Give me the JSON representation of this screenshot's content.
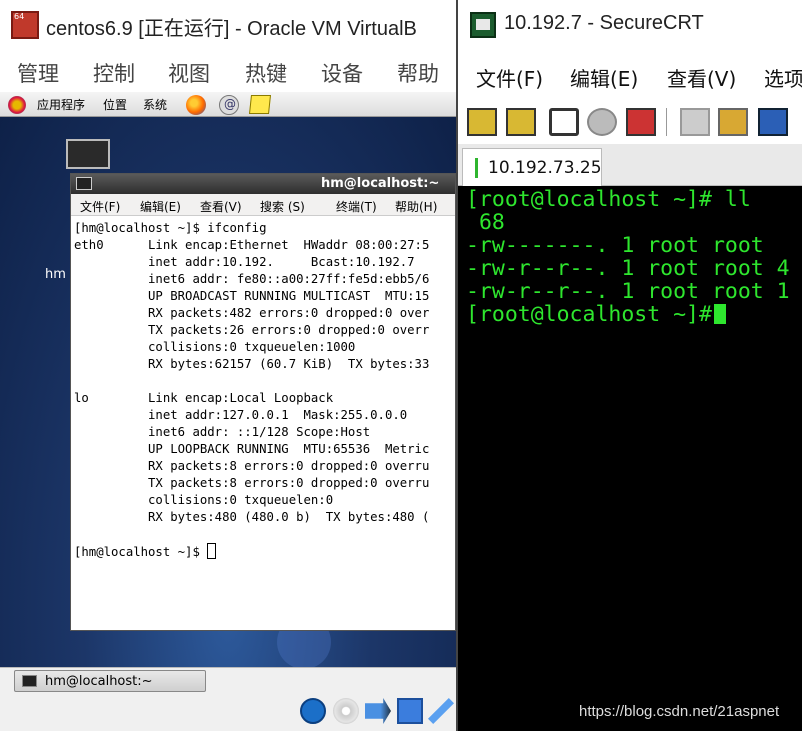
{
  "vbox": {
    "title": "centos6.9 [正在运行] - Oracle VM VirtualB",
    "app_icon_badge": "64",
    "menu": [
      "管理",
      "控制",
      "视图",
      "热键",
      "设备",
      "帮助"
    ]
  },
  "guest": {
    "panel": {
      "applications": "应用程序",
      "places": "位置",
      "system": "系统"
    },
    "desktop_icon_label": "hm",
    "terminal": {
      "title": "hm@localhost:~",
      "menu": [
        "文件(F)",
        "编辑(E)",
        "查看(V)",
        "搜索 (S)",
        "终端(T)",
        "帮助(H)"
      ],
      "lines": [
        "[hm@localhost ~]$ ifconfig",
        "eth0      Link encap:Ethernet  HWaddr 08:00:27:5",
        "          inet addr:10.192.     Bcast:10.192.7",
        "          inet6 addr: fe80::a00:27ff:fe5d:ebb5/6",
        "          UP BROADCAST RUNNING MULTICAST  MTU:15",
        "          RX packets:482 errors:0 dropped:0 over",
        "          TX packets:26 errors:0 dropped:0 overr",
        "          collisions:0 txqueuelen:1000",
        "          RX bytes:62157 (60.7 KiB)  TX bytes:33",
        "",
        "lo        Link encap:Local Loopback",
        "          inet addr:127.0.0.1  Mask:255.0.0.0",
        "          inet6 addr: ::1/128 Scope:Host",
        "          UP LOOPBACK RUNNING  MTU:65536  Metric",
        "          RX packets:8 errors:0 dropped:0 overru",
        "          TX packets:8 errors:0 dropped:0 overru",
        "          collisions:0 txqueuelen:0",
        "          RX bytes:480 (480.0 b)  TX bytes:480 (",
        "",
        "[hm@localhost ~]$ "
      ]
    },
    "taskbar_item": "hm@localhost:~"
  },
  "crt": {
    "title": "10.192.7      - SecureCRT",
    "menu": [
      "文件(F)",
      "编辑(E)",
      "查看(V)",
      "选项"
    ],
    "tab": "10.192.73.25",
    "lines": [
      "[root@localhost ~]# ll",
      " 68",
      "-rw-------. 1 root root",
      "-rw-r--r--. 1 root root 4",
      "-rw-r--r--. 1 root root 1",
      "[root@localhost ~]#"
    ]
  },
  "watermark": "https://blog.csdn.net/21aspnet"
}
